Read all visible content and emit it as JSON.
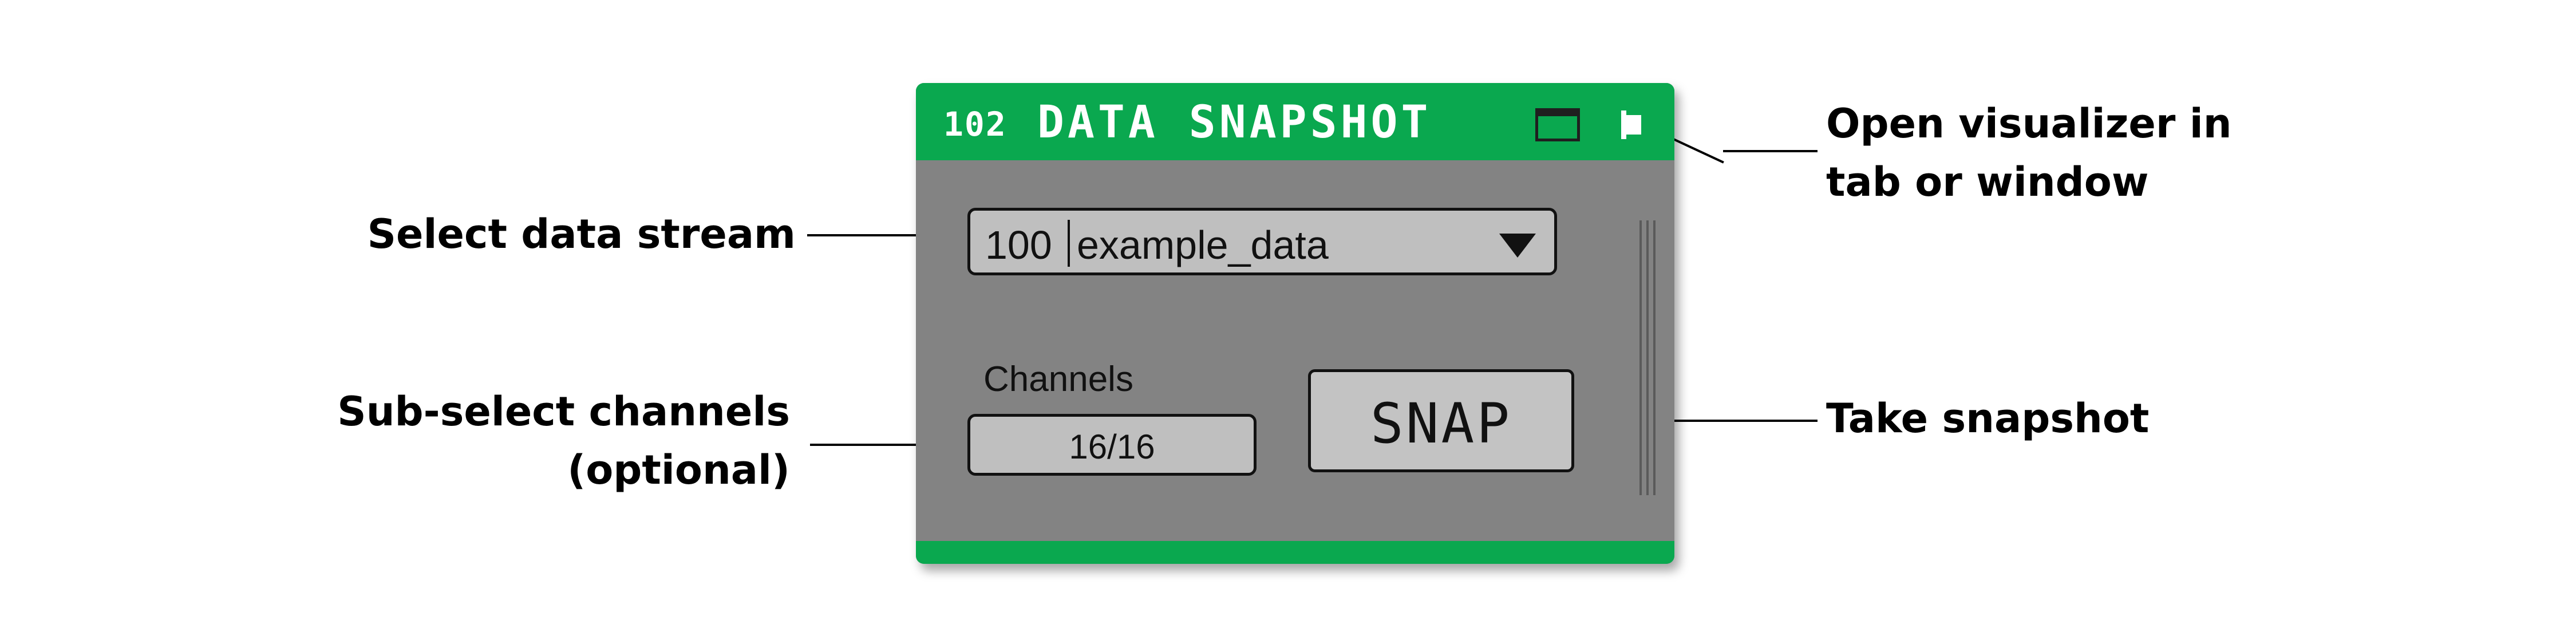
{
  "widget": {
    "number": "102",
    "title": "DATA SNAPSHOT",
    "accent_color": "#0aa84f",
    "body_color": "#838383",
    "header_icons": [
      "window-icon",
      "tab-icon"
    ]
  },
  "stream_select": {
    "stream_id": "100",
    "stream_name": "example_data"
  },
  "channels": {
    "label": "Channels",
    "value": "16/16"
  },
  "snap_button": {
    "label": "SNAP"
  },
  "annotations": {
    "open_visualizer": [
      "Open visualizer in",
      "tab or window"
    ],
    "select_stream": "Select data stream",
    "sub_select": [
      "Sub-select channels",
      "(optional)"
    ],
    "take_snapshot": "Take snapshot"
  }
}
